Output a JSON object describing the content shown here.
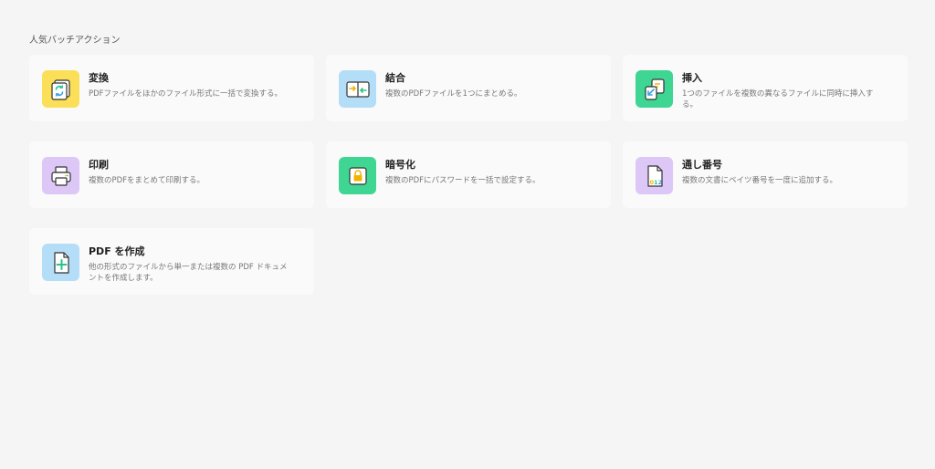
{
  "section": {
    "title": "人気バッチアクション"
  },
  "actions": [
    {
      "title": "変換",
      "description": "PDFファイルをほかのファイル形式に一括で変換する。",
      "icon": "convert-icon",
      "color": "#fbdf59"
    },
    {
      "title": "結合",
      "description": "複数のPDFファイルを1つにまとめる。",
      "icon": "merge-icon",
      "color": "#b4def8"
    },
    {
      "title": "挿入",
      "description": "1つのファイルを複数の異なるファイルに同時に挿入する。",
      "icon": "insert-icon",
      "color": "#3fd694"
    },
    {
      "title": "印刷",
      "description": "複数のPDFをまとめて印刷する。",
      "icon": "printer-icon",
      "color": "#ddc7f7"
    },
    {
      "title": "暗号化",
      "description": "複数のPDFにパスワードを一括で設定する。",
      "icon": "lock-icon",
      "color": "#3fd694"
    },
    {
      "title": "通し番号",
      "description": "複数の文書にベイツ番号を一度に追加する。",
      "icon": "bates-number-icon",
      "color": "#ddc7f7",
      "icon_text": "012"
    },
    {
      "title": "PDF を作成",
      "description": "他の形式のファイルから単一または複数の PDF ドキュメントを作成します。",
      "icon": "create-pdf-icon",
      "color": "#b4def8"
    }
  ]
}
